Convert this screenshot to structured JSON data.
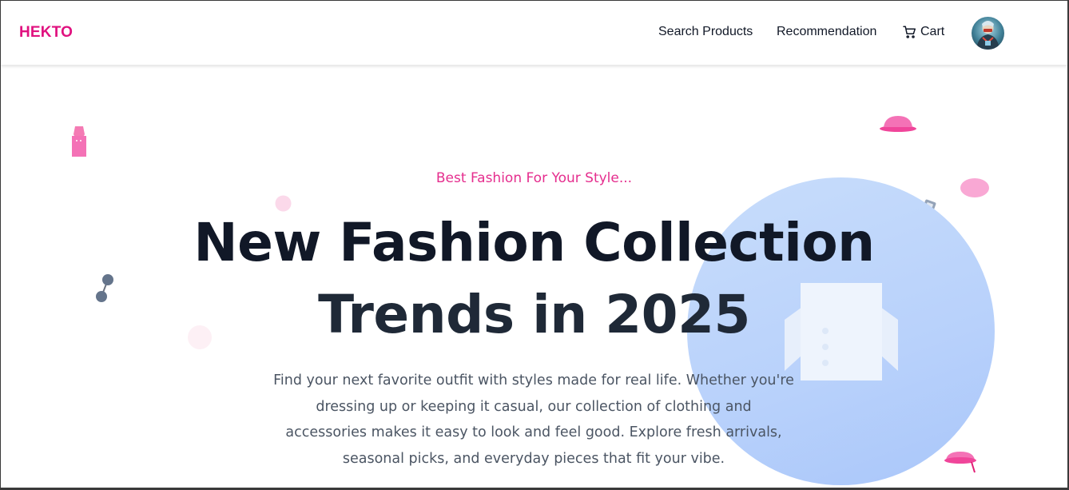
{
  "app": {
    "logo": "HEKTO",
    "brand_color": "#e0117f"
  },
  "nav": {
    "search_label": "Search Products",
    "recommendation_label": "Recommendation",
    "cart_label": "Cart",
    "cart_icon": "cart-icon",
    "avatar_icon": "user-avatar"
  },
  "hero": {
    "tagline": "Best Fashion For Your Style...",
    "headline_line1": "New Fashion Collection",
    "headline_line2": "Trends in 2025",
    "description_lines": [
      "Find your next favorite outfit with styles made for real life. Whether you're",
      "dressing up or keeping it casual, our collection of clothing and",
      "accessories makes it easy to look and feel good. Explore fresh arrivals,",
      "seasonal picks, and everyday pieces that fit your vibe."
    ],
    "accent_color": "#e52e8e",
    "circle_color": "#bfd6fb"
  }
}
